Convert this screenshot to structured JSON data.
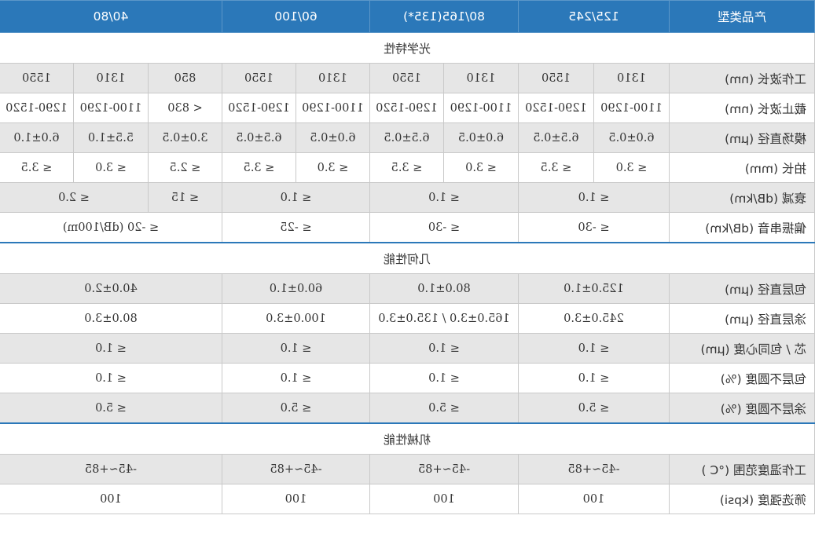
{
  "header": [
    "产品类型",
    "125/245",
    "80/165(135*)",
    "60/100",
    "40/80"
  ],
  "sections": {
    "optical": "光学特性",
    "geometry": "几何性能",
    "mechanical": "机械性能"
  },
  "rows": {
    "wavelength": {
      "label": "工作波长 (nm)",
      "cells": [
        "1310",
        "1550",
        "1310",
        "1550",
        "1310",
        "1550",
        "850",
        "1310",
        "1550"
      ]
    },
    "cutoff": {
      "label": "截止波长 (nm)",
      "cells": [
        "1100-1290",
        "1290-1520",
        "1100-1290",
        "1290-1520",
        "1100-1290",
        "1290-1520",
        "< 830",
        "1100-1290",
        "1290-1520"
      ]
    },
    "mfd": {
      "label": "模场直径 (μm)",
      "cells": [
        "6.0±0.5",
        "6.5±0.5",
        "6.0±0.5",
        "6.5±0.5",
        "6.0±0.5",
        "6.5±0.5",
        "3.0±0.5",
        "5.5±1.0",
        "6.0±1.0"
      ]
    },
    "beat": {
      "label": "拍长 (mm)",
      "cells": [
        "≤ 3.0",
        "≤ 3.5",
        "≤ 3.0",
        "≤ 3.5",
        "≤ 3.0",
        "≤ 3.5",
        "≤ 2.5",
        "≤ 3.0",
        "≤ 3.5"
      ]
    },
    "atten": {
      "label": "衰减 (dB/km)",
      "cells": [
        "≤ 1.0",
        "≤ 1.0",
        "≤ 1.0",
        "≤ 15",
        "≤ 2.0"
      ]
    },
    "crosstalk": {
      "label": "偏振串音 (dB/km)",
      "cells": [
        "≤ -30",
        "≤ -30",
        "≤ -25",
        "≤ -20 (dB/100m)"
      ]
    },
    "cladding": {
      "label": "包层直径 (μm)",
      "cells": [
        "125.0±1.0",
        "80.0±1.0",
        "60.0±1.0",
        "40.0±2.0"
      ]
    },
    "coating": {
      "label": "涂层直径 (μm)",
      "cells": [
        "245.0±3.0",
        "165.0±3.0 / 135.0±3.0",
        "100.0±3.0",
        "80.0±3.0"
      ]
    },
    "concentricity": {
      "label": "芯 / 包同心度 (μm)",
      "cells": [
        "≤ 1.0",
        "≤ 1.0",
        "≤ 1.0",
        "≤ 1.0"
      ]
    },
    "clad_noncirc": {
      "label": "包层不圆度 (%)",
      "cells": [
        "≤ 1.0",
        "≤ 1.0",
        "≤ 1.0",
        "≤ 1.0"
      ]
    },
    "coat_noncirc": {
      "label": "涂层不圆度 (%)",
      "cells": [
        "≤ 5.0",
        "≤ 5.0",
        "≤ 5.0",
        "≤ 5.0"
      ]
    },
    "temp": {
      "label": "工作温度范围 (°C )",
      "cells": [
        "-45~+85",
        "-45~+85",
        "-45~+85",
        "-45~+85"
      ]
    },
    "proof": {
      "label": "筛选强度 (kpsi)",
      "cells": [
        "100",
        "100",
        "100",
        "100"
      ]
    }
  }
}
